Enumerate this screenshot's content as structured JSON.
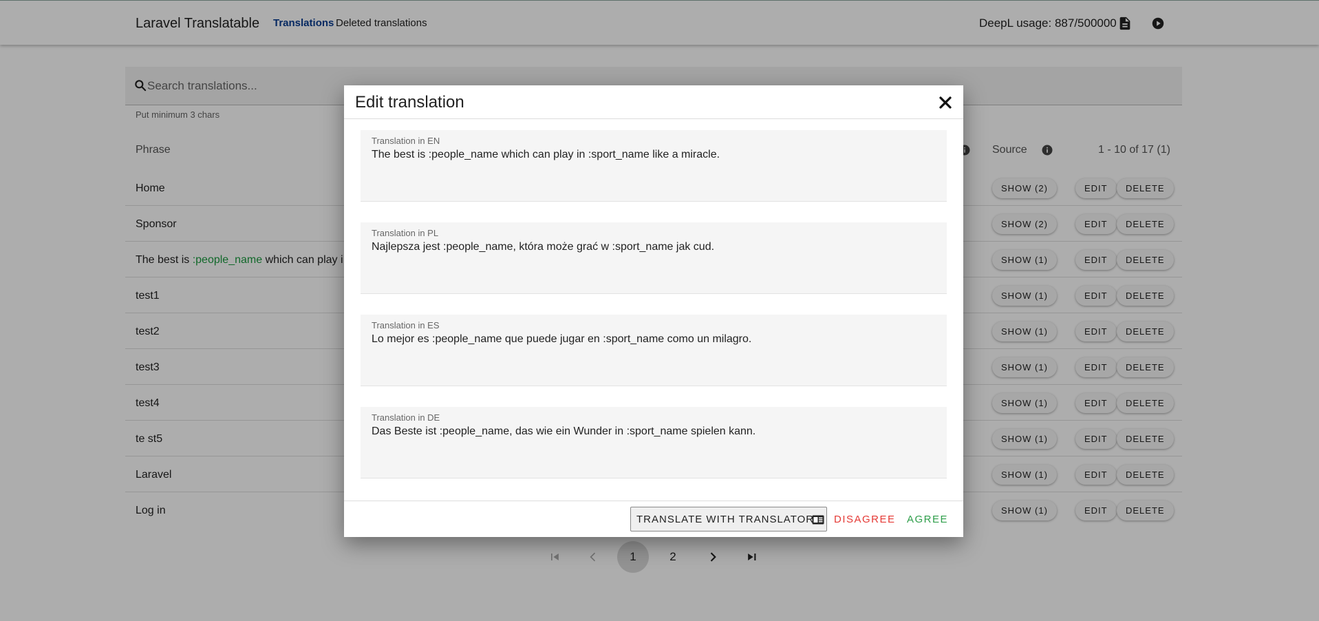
{
  "app": {
    "title": "Laravel Translatable",
    "nav": [
      "Translations",
      "Deleted translations"
    ],
    "deepl_usage": "DeepL usage: 887/500000"
  },
  "search": {
    "placeholder": "Search translations...",
    "hint": "Put minimum 3 chars"
  },
  "table": {
    "headers": {
      "phrase": "Phrase",
      "source": "Source"
    },
    "pagination_info": "1 - 10 of 17 (1)",
    "rows": [
      {
        "phrase": "Home",
        "show": "SHOW (2)",
        "edit": "EDIT",
        "delete": "DELETE"
      },
      {
        "phrase": "Sponsor",
        "show": "SHOW (2)",
        "edit": "EDIT",
        "delete": "DELETE"
      },
      {
        "phrase_pre": "The best is ",
        "phrase_ph": ":people_name",
        "phrase_post": " which can play i",
        "show": "SHOW (1)",
        "edit": "EDIT",
        "delete": "DELETE"
      },
      {
        "phrase": "test1",
        "show": "SHOW (1)",
        "edit": "EDIT",
        "delete": "DELETE"
      },
      {
        "phrase": "test2",
        "show": "SHOW (1)",
        "edit": "EDIT",
        "delete": "DELETE"
      },
      {
        "phrase": "test3",
        "show": "SHOW (1)",
        "edit": "EDIT",
        "delete": "DELETE"
      },
      {
        "phrase": "test4",
        "show": "SHOW (1)",
        "edit": "EDIT",
        "delete": "DELETE"
      },
      {
        "phrase": "te st5",
        "show": "SHOW (1)",
        "edit": "EDIT",
        "delete": "DELETE"
      },
      {
        "phrase": "Laravel",
        "show": "SHOW (1)",
        "edit": "EDIT",
        "delete": "DELETE"
      },
      {
        "phrase": "Log in",
        "show": "SHOW (1)",
        "edit": "EDIT",
        "delete": "DELETE"
      }
    ]
  },
  "pagination": {
    "pages": [
      "1",
      "2"
    ],
    "current": "1"
  },
  "dialog": {
    "title": "Edit translation",
    "fields": [
      {
        "label": "Translation in EN",
        "value": "The best is :people_name which can play in :sport_name like a miracle."
      },
      {
        "label": "Translation in PL",
        "value": "Najlepsza jest :people_name, która może grać w :sport_name jak cud."
      },
      {
        "label": "Translation in ES",
        "value": "Lo mejor es :people_name que puede jugar en :sport_name como un milagro."
      },
      {
        "label": "Translation in DE",
        "value": "Das Beste ist :people_name, das wie ein Wunder in :sport_name spielen kann."
      }
    ],
    "translate_label": "TRANSLATE WITH TRANSLATOR",
    "disagree_label": "DISAGREE",
    "agree_label": "AGREE"
  },
  "colors": {
    "nav_active": "#0a3d91",
    "placeholder_green": "#1a9a3f",
    "disagree_red": "#e53935",
    "agree_green": "#2e9e4a"
  },
  "icons": [
    "document-icon",
    "play-circle-icon",
    "search-icon",
    "info-icon",
    "first-page-icon",
    "prev-page-icon",
    "next-page-icon",
    "last-page-icon",
    "close-icon",
    "translate-card-icon"
  ]
}
